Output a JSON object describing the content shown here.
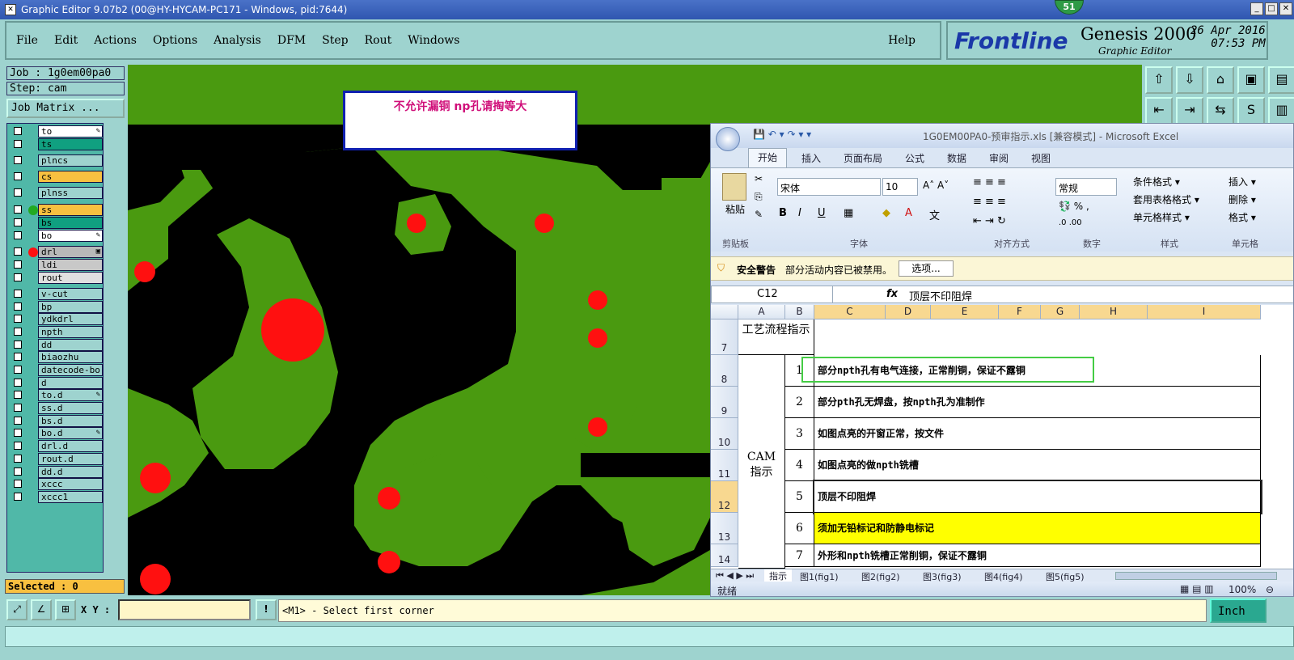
{
  "window": {
    "title": "Graphic Editor 9.07b2 (00@HY-HYCAM-PC171 - Windows, pid:7644)",
    "notify_count": "51"
  },
  "menu": {
    "items": [
      "File",
      "Edit",
      "Actions",
      "Options",
      "Analysis",
      "DFM",
      "Step",
      "Rout",
      "Windows"
    ],
    "help": "Help"
  },
  "brand": {
    "logo": "Frontline",
    "product": "Genesis 2000",
    "subtitle": "Graphic Editor",
    "date": "26 Apr 2016",
    "time": "07:53 PM"
  },
  "job": {
    "job_label": "Job : 1g0em00pa0",
    "step_label": "Step: cam",
    "matrix_button": "Job Matrix ..."
  },
  "layers": [
    {
      "name": "to",
      "color": "#ffffff",
      "mark": "✎",
      "dot": ""
    },
    {
      "name": "ts",
      "color": "#10a080",
      "mark": "",
      "dot": ""
    },
    {
      "name": "plncs",
      "color": "#9ed3cf",
      "mark": "",
      "dot": ""
    },
    {
      "name": "cs",
      "color": "#f8c040",
      "mark": "",
      "dot": ""
    },
    {
      "name": "plnss",
      "color": "#9ed3cf",
      "mark": "",
      "dot": ""
    },
    {
      "name": "ss",
      "color": "#f8c040",
      "mark": "",
      "dot": "#22aa22"
    },
    {
      "name": "bs",
      "color": "#10a080",
      "mark": "",
      "dot": ""
    },
    {
      "name": "bo",
      "color": "#ffffff",
      "mark": "✎",
      "dot": ""
    },
    {
      "name": "drl",
      "color": "#b8b8b8",
      "mark": "▣",
      "dot": "#ff1010"
    },
    {
      "name": "ldi",
      "color": "#c8c8c8",
      "mark": "",
      "dot": ""
    },
    {
      "name": "rout",
      "color": "#e0e0e0",
      "mark": "",
      "dot": ""
    },
    {
      "name": "v-cut",
      "color": "#9ed3cf",
      "mark": "",
      "dot": ""
    },
    {
      "name": "bp",
      "color": "#9ed3cf",
      "mark": "",
      "dot": ""
    },
    {
      "name": "ydkdrl",
      "color": "#9ed3cf",
      "mark": "",
      "dot": ""
    },
    {
      "name": "npth",
      "color": "#9ed3cf",
      "mark": "",
      "dot": ""
    },
    {
      "name": "dd",
      "color": "#9ed3cf",
      "mark": "",
      "dot": ""
    },
    {
      "name": "biaozhu",
      "color": "#9ed3cf",
      "mark": "",
      "dot": ""
    },
    {
      "name": "datecode-bo",
      "color": "#9ed3cf",
      "mark": "",
      "dot": ""
    },
    {
      "name": "d",
      "color": "#9ed3cf",
      "mark": "",
      "dot": ""
    },
    {
      "name": "to.d",
      "color": "#9ed3cf",
      "mark": "✎",
      "dot": ""
    },
    {
      "name": "ss.d",
      "color": "#9ed3cf",
      "mark": "",
      "dot": ""
    },
    {
      "name": "bs.d",
      "color": "#9ed3cf",
      "mark": "",
      "dot": ""
    },
    {
      "name": "bo.d",
      "color": "#9ed3cf",
      "mark": "✎",
      "dot": ""
    },
    {
      "name": "drl.d",
      "color": "#9ed3cf",
      "mark": "",
      "dot": ""
    },
    {
      "name": "rout.d",
      "color": "#9ed3cf",
      "mark": "",
      "dot": ""
    },
    {
      "name": "dd.d",
      "color": "#9ed3cf",
      "mark": "",
      "dot": ""
    },
    {
      "name": "xccc",
      "color": "#9ed3cf",
      "mark": "",
      "dot": ""
    },
    {
      "name": "xccc1",
      "color": "#9ed3cf",
      "mark": "",
      "dot": ""
    }
  ],
  "selected": "Selected : 0",
  "canvas": {
    "note": "不允许漏铜   np孔请掏等大"
  },
  "status": {
    "xy_label": "X Y :",
    "prompt": "<M1> - Select first corner",
    "units": "Inch"
  },
  "excel": {
    "title": "1G0EM00PA0-预审指示.xls  [兼容模式] - Microsoft Excel",
    "tabs": [
      "开始",
      "插入",
      "页面布局",
      "公式",
      "数据",
      "审阅",
      "视图"
    ],
    "font_name": "宋体",
    "font_size": "10",
    "number_format": "常规",
    "paste": "粘贴",
    "groups": [
      "剪贴板",
      "字体",
      "对齐方式",
      "数字",
      "样式",
      "单元格"
    ],
    "styles": [
      "条件格式 ▾",
      "套用表格格式 ▾",
      "单元格样式 ▾"
    ],
    "cells_cmds": [
      "插入 ▾",
      "删除 ▾",
      "格式 ▾"
    ],
    "security_label": "安全警告",
    "security_text": "部分活动内容已被禁用。",
    "options_button": "选项...",
    "name_box": "C12",
    "formula": "顶层不印阻焊",
    "columns": [
      "A",
      "B",
      "C",
      "D",
      "E",
      "F",
      "G",
      "H",
      "I"
    ],
    "section_header": "工艺流程指示",
    "section_cam": "CAM 指示",
    "rows": [
      {
        "row": "7",
        "num": "",
        "text": ""
      },
      {
        "row": "8",
        "num": "1",
        "text": "部分npth孔有电气连接，正常削铜，保证不露铜"
      },
      {
        "row": "9",
        "num": "2",
        "text": "部分pth孔无焊盘，按npth孔为准制作"
      },
      {
        "row": "10",
        "num": "3",
        "text": "如图点亮的开窗正常，按文件"
      },
      {
        "row": "11",
        "num": "4",
        "text": "如图点亮的做npth铣槽"
      },
      {
        "row": "12",
        "num": "5",
        "text": "顶层不印阻焊"
      },
      {
        "row": "13",
        "num": "6",
        "text": "须加无铅标记和防静电标记"
      },
      {
        "row": "14",
        "num": "7",
        "text": "外形和npth铣槽正常削铜，保证不露铜"
      }
    ],
    "sheets": [
      "指示",
      "图1(fig1)",
      "图2(fig2)",
      "图3(fig3)",
      "图4(fig4)",
      "图5(fig5)"
    ],
    "status_ready": "就绪",
    "zoom": "100%"
  }
}
